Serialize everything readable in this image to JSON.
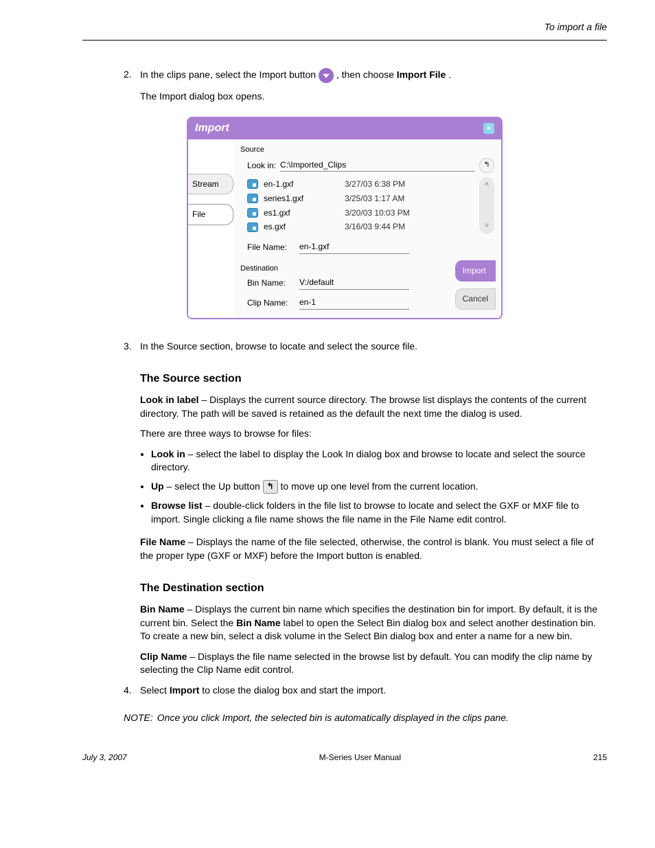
{
  "header": {
    "right": "To import a file"
  },
  "step2": {
    "num": "2.",
    "text_a": "In the clips pane, select the Import button ",
    "text_b": ", then choose ",
    "bold": "Import File",
    "text_c": "."
  },
  "note2": "The Import dialog box opens.",
  "dialog": {
    "title": "Import",
    "tabs": {
      "stream": "Stream",
      "file": "File"
    },
    "source_label": "Source",
    "lookin_label": "Look in:",
    "lookin_path": "C:\\Imported_Clips",
    "files": [
      {
        "name": "en-1.gxf",
        "date": "3/27/03 6:38 PM"
      },
      {
        "name": "series1.gxf",
        "date": "3/25/03 1:17 AM"
      },
      {
        "name": "es1.gxf",
        "date": "3/20/03 10:03 PM"
      },
      {
        "name": "es.gxf",
        "date": "3/16/03 9:44 PM"
      }
    ],
    "filename_label": "File Name:",
    "filename_value": "en-1.gxf",
    "dest_label": "Destination",
    "binname_label": "Bin Name:",
    "binname_value": "V:/default",
    "clipname_label": "Clip Name:",
    "clipname_value": "en-1",
    "import_btn": "Import",
    "cancel_btn": "Cancel"
  },
  "step3": {
    "num": "3.",
    "text": "In the Source section, browse to locate and select the source file."
  },
  "source": {
    "heading": "The Source section",
    "lookin_bold": "Look in label",
    "lookin_text": " – Displays the current source directory. The browse list displays the contents of the current directory. The path will be saved is retained as the default the next time the dialog is used.",
    "ways_intro": "There are three ways to browse for files:",
    "bullets": [
      {
        "b": "Look in",
        "t": " – select the label to display the Look In dialog box and browse to locate and select the source directory."
      },
      {
        "b": "Up",
        "mid": " – select the Up button ",
        "t2": " to move up one level from the current location."
      },
      {
        "b": "Browse list",
        "t": " – double-click folders in the file list to browse to locate and select the GXF or MXF file to import. Single clicking a file name shows the file name in the File Name edit control."
      }
    ],
    "fn_bold": "File Name",
    "fn_text": " – Displays the name of the file selected, otherwise, the control is blank. You must select a file of the proper type (GXF or MXF) before the Import button is enabled."
  },
  "dest": {
    "heading": "The Destination section",
    "bin_bold": "Bin Name",
    "bin_text1": " – Displays the current bin name which specifies the destination bin for import. By default, it is the current bin. Select the ",
    "bin_bold2": "Bin Name",
    "bin_text2": " label to open the Select Bin dialog box and select another destination bin. To create a new bin, select a disk volume in the Select Bin dialog box and enter a name for a new bin.",
    "clip_bold": "Clip Name",
    "clip_text": " – Displays the file name selected in the browse list by default. You can modify the clip name by selecting the Clip Name edit control."
  },
  "step4": {
    "num": "4.",
    "text_a": "Select ",
    "bold": "Import",
    "text_b": " to close the dialog box and start the import."
  },
  "footer": {
    "left": "July 3, 2007",
    "center": "M-Series User Manual",
    "right": "215"
  }
}
